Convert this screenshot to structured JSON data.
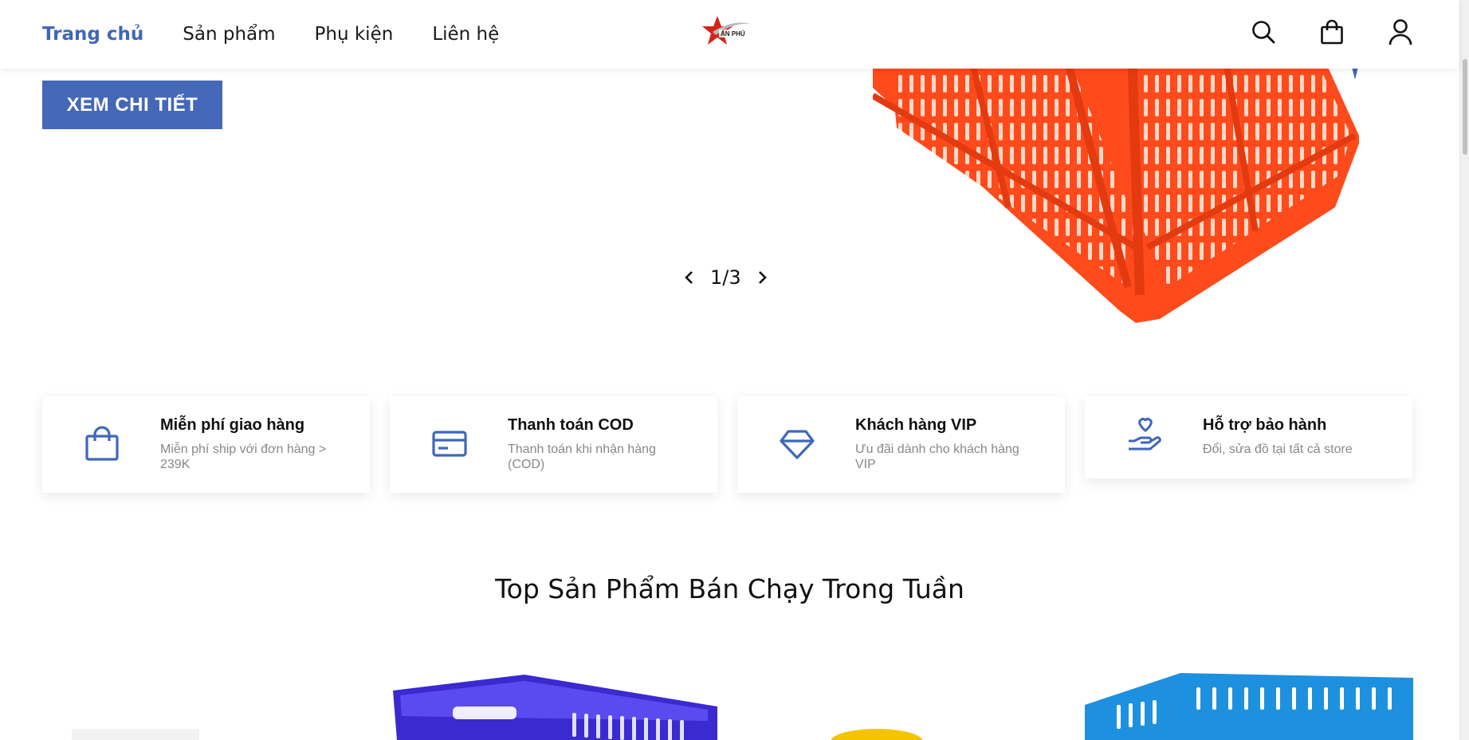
{
  "header": {
    "nav": [
      {
        "label": "Trang chủ",
        "active": true
      },
      {
        "label": "Sản phẩm",
        "active": false
      },
      {
        "label": "Phụ kiện",
        "active": false
      },
      {
        "label": "Liên hệ",
        "active": false
      }
    ],
    "logo_icon": "star-logo",
    "icons": [
      "search-icon",
      "shopping-bag-icon",
      "user-icon"
    ]
  },
  "hero": {
    "button_label": "XEM CHI TIẾT",
    "slide_counter": "1/3",
    "image": "orange-plastic-crate"
  },
  "features": [
    {
      "icon": "shopping-bag-icon",
      "title": "Miễn phí giao hàng",
      "desc": "Miễn phí ship với đơn hàng > 239K"
    },
    {
      "icon": "credit-card-icon",
      "title": "Thanh toán COD",
      "desc": "Thanh toán khi nhận hàng (COD)"
    },
    {
      "icon": "diamond-icon",
      "title": "Khách hàng VIP",
      "desc": "Ưu đãi dành cho khách hàng VIP"
    },
    {
      "icon": "heart-hand-icon",
      "title": "Hỗ trợ bảo hành",
      "desc": "Đổi, sửa đồ tại tất cả store"
    }
  ],
  "section": {
    "title": "Top Sản Phẩm Bán Chạy Trong Tuần"
  },
  "colors": {
    "accent": "#4567b7",
    "crate_orange": "#ff4b1f",
    "crate_blue": "#1e90e0",
    "crate_purple": "#3a2ad0",
    "crate_yellow": "#f5c400"
  }
}
